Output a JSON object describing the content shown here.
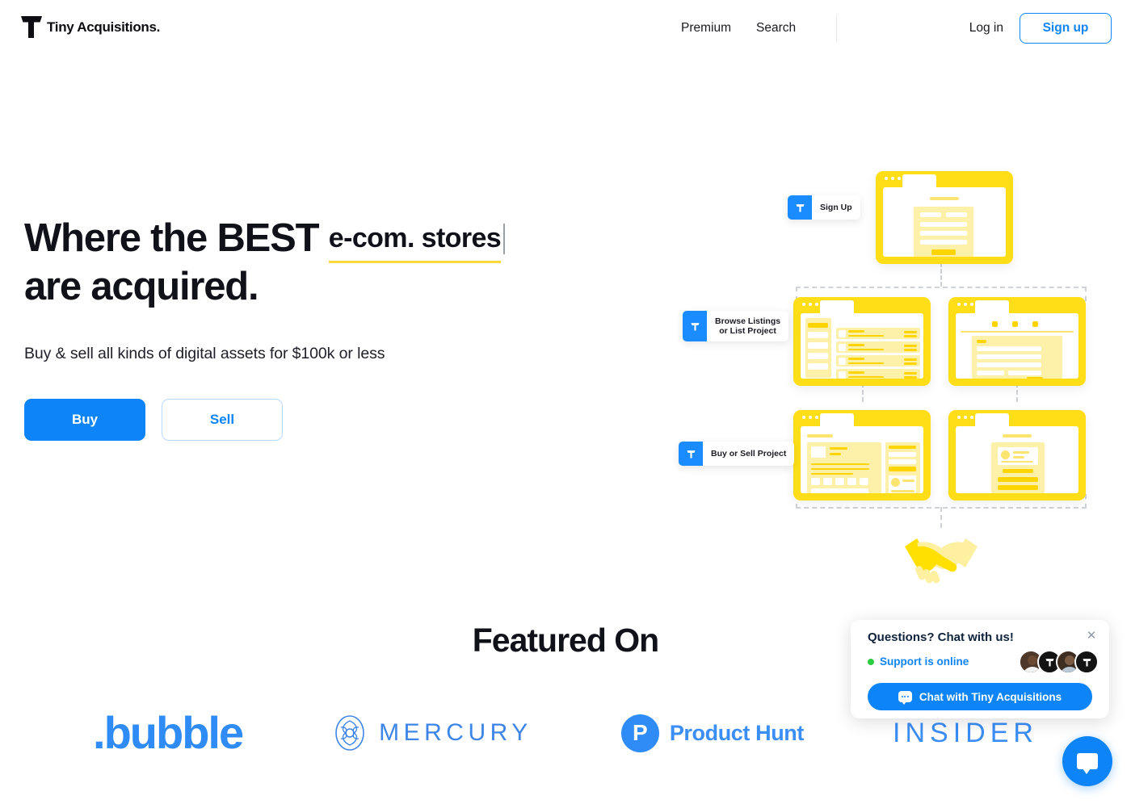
{
  "header": {
    "logo_text": "Tiny Acquisitions.",
    "logo_icon": "tiny-acquisitions-t-logo",
    "nav": [
      {
        "label": "Premium"
      },
      {
        "label": "Search"
      }
    ],
    "login_label": "Log in",
    "signup_label": "Sign up"
  },
  "hero": {
    "headline_line1": "Where the BEST",
    "headline_typed": "e-com. stores",
    "headline_line2": "are acquired.",
    "subhead": "Buy & sell all kinds of digital assets for $100k or less",
    "buy_label": "Buy",
    "sell_label": "Sell",
    "underline_color": "#ffd83d",
    "accent_color": "#0d84f7"
  },
  "illustration": {
    "steps": [
      {
        "label": "Sign Up",
        "icon": "t-badge-icon"
      },
      {
        "label": "Browse Listings\nor List Project",
        "icon": "t-badge-icon"
      },
      {
        "label": "Buy or Sell Project",
        "icon": "t-badge-icon"
      }
    ],
    "handshake_icon": "handshake-icon",
    "window_color": "#ffde17"
  },
  "featured": {
    "title": "Featured On",
    "logos": [
      {
        "name": "bubble",
        "text": ".bubble"
      },
      {
        "name": "mercury",
        "text": "MERCURY"
      },
      {
        "name": "product-hunt",
        "text": "Product Hunt",
        "mark": "P"
      },
      {
        "name": "insider",
        "text": "INSIDER"
      }
    ]
  },
  "chat": {
    "title": "Questions? Chat with us!",
    "close_icon": "close-icon",
    "status": "Support is online",
    "status_color": "#2ecc40",
    "button_label": "Chat with Tiny Acquisitions",
    "avatars": [
      "photo",
      "t-logo",
      "photo",
      "t-logo"
    ],
    "fab_icon": "chat-bubble-icon"
  }
}
